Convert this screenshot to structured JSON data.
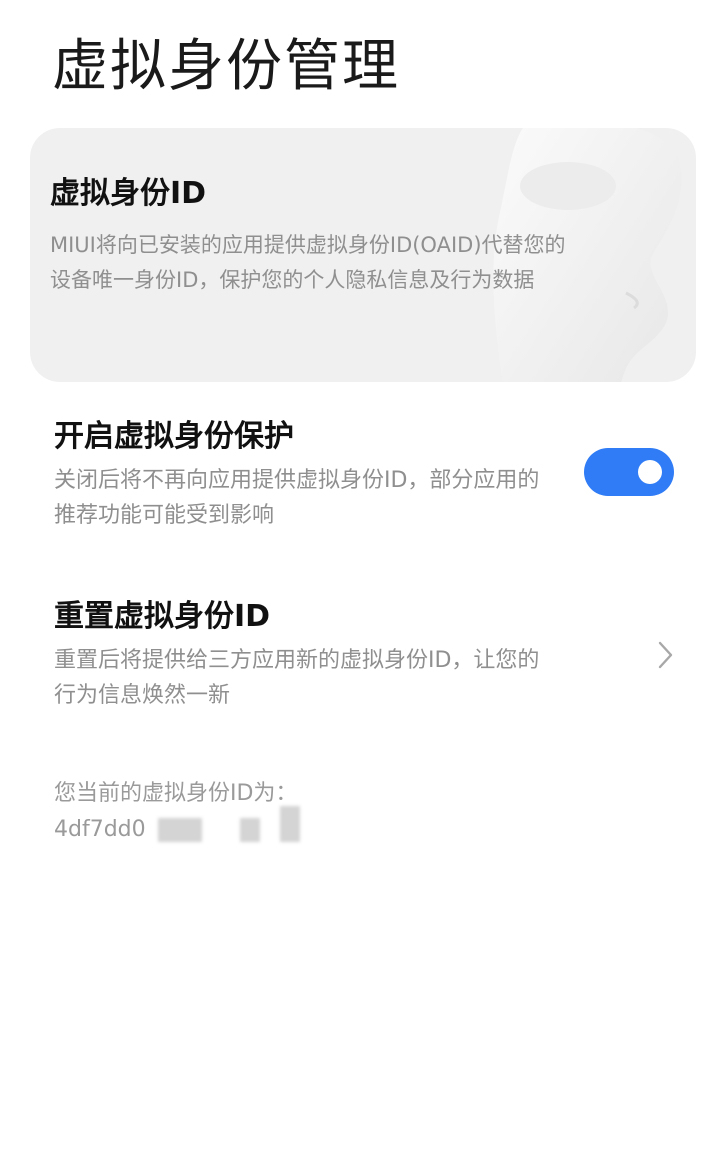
{
  "page": {
    "title": "虚拟身份管理"
  },
  "hero": {
    "title": "虚拟身份ID",
    "description": "MIUI将向已安装的应用提供虚拟身份ID(OAID)代替您的设备唯一身份ID，保护您的个人隐私信息及行为数据",
    "icon": "mask-icon"
  },
  "protection": {
    "title": "开启虚拟身份保护",
    "description": "关闭后将不再向应用提供虚拟身份ID，部分应用的推荐功能可能受到影响",
    "enabled": true
  },
  "reset": {
    "title": "重置虚拟身份ID",
    "description": "重置后将提供给三方应用新的虚拟身份ID，让您的行为信息焕然一新",
    "icon": "chevron-right-icon"
  },
  "current_id": {
    "label": "您当前的虚拟身份ID为：",
    "value_visible": "4df7dd0"
  },
  "colors": {
    "accent": "#2f7cf6",
    "card_background": "#f0f0f0",
    "primary_text": "#111111",
    "secondary_text": "#8f8f8f"
  }
}
